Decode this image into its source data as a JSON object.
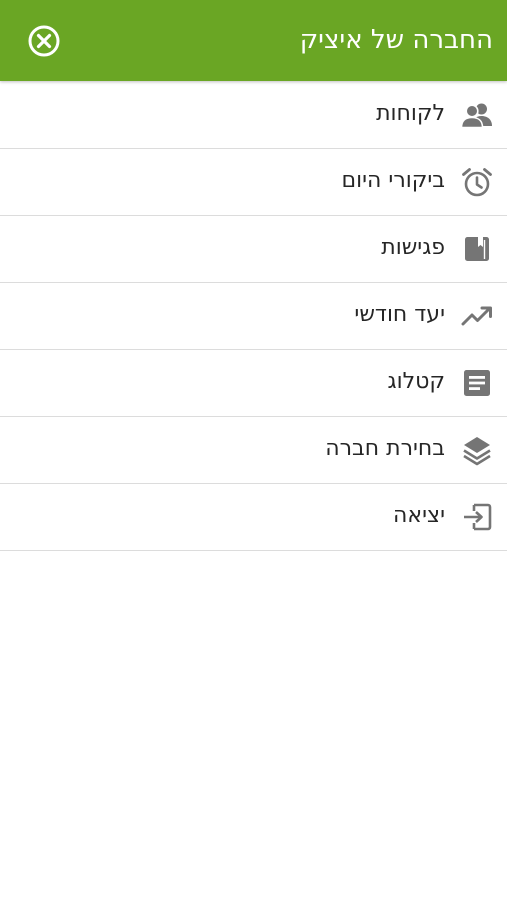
{
  "header": {
    "title": "החברה של איציק",
    "close_icon": "close-circle-icon",
    "background_color": "#6aa624"
  },
  "menu": {
    "items": [
      {
        "label": "לקוחות",
        "icon": "users-icon"
      },
      {
        "label": "ביקורי היום",
        "icon": "alarm-clock-icon"
      },
      {
        "label": "פגישות",
        "icon": "book-icon"
      },
      {
        "label": "יעד חודשי",
        "icon": "trending-up-icon"
      },
      {
        "label": "קטלוג",
        "icon": "document-icon"
      },
      {
        "label": "בחירת חברה",
        "icon": "layers-icon"
      },
      {
        "label": "יציאה",
        "icon": "exit-icon"
      }
    ]
  },
  "colors": {
    "accent": "#6aa624",
    "icon": "#757575",
    "text": "#262626",
    "divider": "#dcdcdc"
  }
}
